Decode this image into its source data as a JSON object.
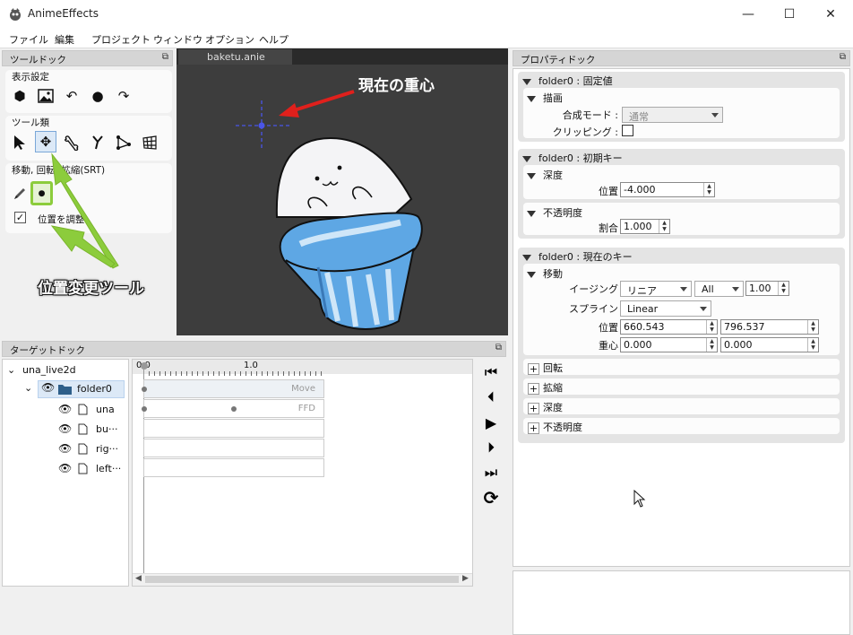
{
  "app": {
    "title": "AnimeEffects"
  },
  "window_controls": {
    "minimize": "—",
    "maximize": "☐",
    "close": "✕"
  },
  "menu": [
    "ファイル",
    "編集",
    "プロジェクト",
    "ウィンドウ",
    "オプション",
    "ヘルプ"
  ],
  "tool_dock": {
    "title": "ツールドック",
    "display_settings": "表示設定",
    "tools_label": "ツール類",
    "srt_label": "移動, 回転, 拡縮(SRT)",
    "adjust_position_label": "位置を調整",
    "adjust_position_checked": true
  },
  "canvas": {
    "tab": "baketu.anie",
    "annotation_center": "現在の重心",
    "annotation_tool": "位置変更ツール"
  },
  "property_dock": {
    "title": "プロパティドック",
    "fixed": {
      "header": "folder0 : 固定値",
      "draw_label": "描画",
      "blend_mode_label": "合成モード :",
      "blend_mode_value": "通常",
      "clipping_label": "クリッピング :"
    },
    "initial_key": {
      "header": "folder0 : 初期キー",
      "depth_label": "深度",
      "position_label": "位置",
      "position_value": "-4.000",
      "opacity_label": "不透明度",
      "ratio_label": "割合",
      "ratio_value": "1.000"
    },
    "current_key": {
      "header": "folder0 : 現在のキー",
      "move_label": "移動",
      "easing_label": "イージング",
      "easing_value": "リニア",
      "easing_range": "All",
      "easing_weight": "1.00",
      "spline_label": "スプライン",
      "spline_value": "Linear",
      "position_label": "位置",
      "position_x": "660.543",
      "position_y": "796.537",
      "centroid_label": "重心",
      "centroid_x": "0.000",
      "centroid_y": "0.000",
      "collapsed": [
        "回転",
        "拡縮",
        "深度",
        "不透明度"
      ]
    }
  },
  "target_dock": {
    "title": "ターゲットドック",
    "tree": {
      "root": "una_live2d",
      "folder": "folder0",
      "children": [
        "una",
        "bu···",
        "rig···",
        "left···"
      ]
    },
    "timeline": {
      "ruler": [
        "0.0",
        "1.0"
      ],
      "tracks": [
        "Move",
        "FFD"
      ]
    }
  },
  "colors": {
    "accent_green": "#8ccc3c",
    "annotation_red": "#e0201c",
    "centroid_blue": "#4a55e8",
    "folder_blue": "#2e5f8a"
  }
}
